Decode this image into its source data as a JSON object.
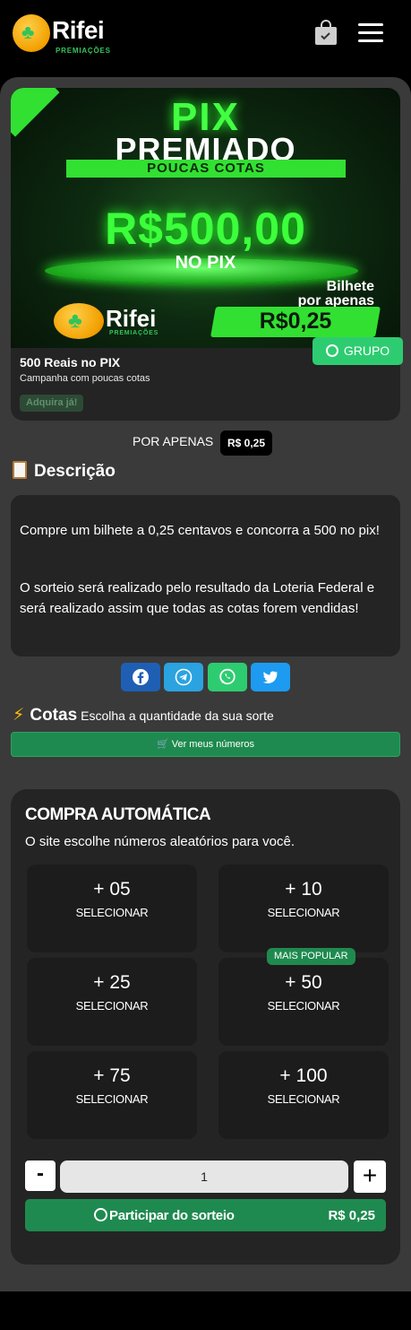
{
  "header": {
    "logo_name": "Rifei",
    "logo_sub": "PREMIAÇÕES",
    "cart_icon": "shopping-bag-check-icon",
    "menu_icon": "hamburger-menu-icon"
  },
  "campaign": {
    "banner": {
      "pix": "PIX",
      "premiado": "PREMIADO",
      "poucas": "POUCAS COTAS",
      "value": "R$500,00",
      "no_pix": "NO PIX",
      "bilhete": "Bilhete",
      "por_apenas": "por apenas",
      "price": "R$0,25",
      "logo_name": "Rifei",
      "logo_sub": "PREMIAÇÕES"
    },
    "title": "500 Reais no PIX",
    "subtitle": "Campanha com poucas cotas",
    "badge": "Adquira já!",
    "grupo_label": "GRUPO"
  },
  "price_line": {
    "label": "POR APENAS",
    "price": "R$ 0,25"
  },
  "description": {
    "heading": "Descrição",
    "p1": "Compre um bilhete a 0,25 centavos e concorra a 500 no pix!",
    "p2": "O sorteio será realizado pelo resultado da Loteria Federal e será realizado assim que todas as cotas forem vendidas!"
  },
  "share": {
    "facebook": "facebook-icon",
    "telegram": "telegram-icon",
    "whatsapp": "whatsapp-icon",
    "twitter": "twitter-icon"
  },
  "cotas": {
    "heading": "Cotas",
    "subtitle": "Escolha a quantidade da sua sorte",
    "meus_numeros": "Ver meus números"
  },
  "auto": {
    "title": "COMPRA AUTOMÁTICA",
    "subtitle": "O site escolhe números aleatórios para você.",
    "options": [
      {
        "num": "+ 05",
        "label": "SELECIONAR"
      },
      {
        "num": "+ 10",
        "label": "SELECIONAR"
      },
      {
        "num": "+ 25",
        "label": "SELECIONAR"
      },
      {
        "num": "+ 50",
        "label": "SELECIONAR"
      },
      {
        "num": "+ 75",
        "label": "SELECIONAR"
      },
      {
        "num": "+ 100",
        "label": "SELECIONAR"
      }
    ],
    "popular": "MAIS POPULAR",
    "minus": "-",
    "plus": "+",
    "quantity": "1",
    "participate": "Participar do sorteio",
    "total": "R$ 0,25"
  },
  "colors": {
    "accent": "#1f8a4f",
    "whatsapp": "#2ecc71",
    "facebook": "#1e5fb4",
    "telegram": "#2aa3e0",
    "twitter": "#1d9bf0"
  }
}
